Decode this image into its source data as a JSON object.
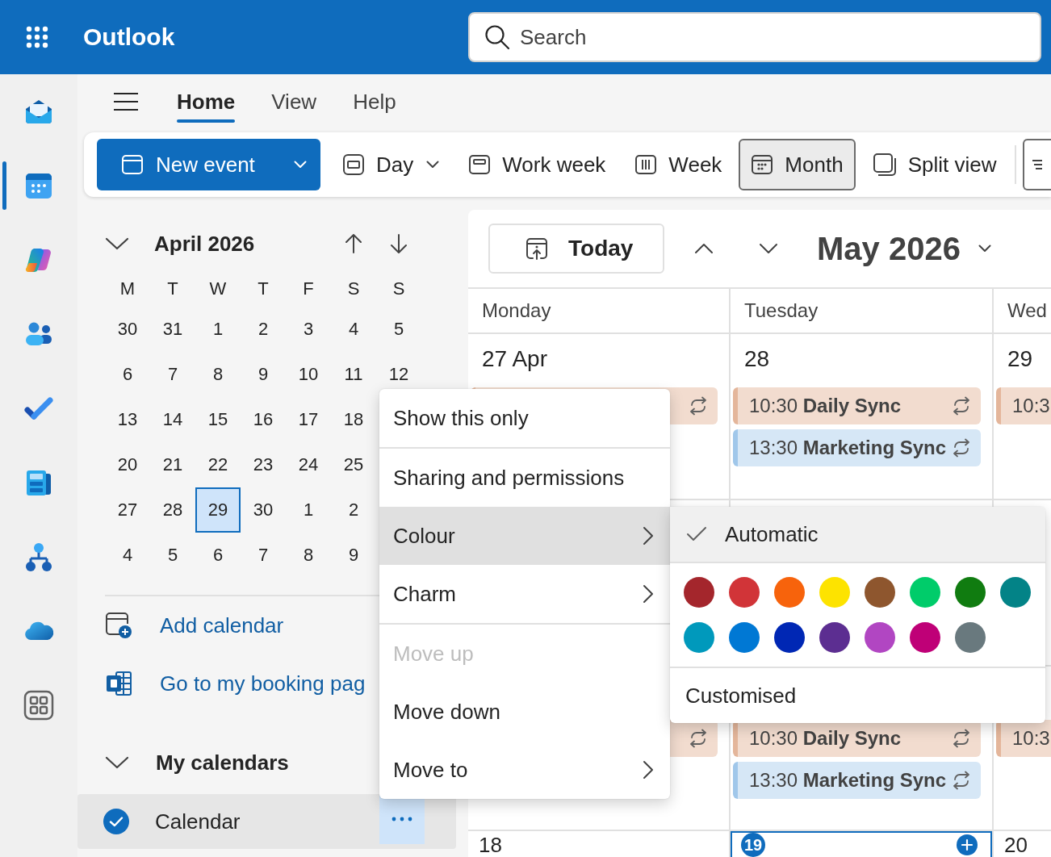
{
  "header": {
    "app_name": "Outlook",
    "search": {
      "placeholder": "Search"
    }
  },
  "rail": [
    {
      "kind": "mail",
      "selected": false
    },
    {
      "kind": "calendar",
      "selected": true
    },
    {
      "kind": "swirl",
      "selected": false
    },
    {
      "kind": "people",
      "selected": false
    },
    {
      "kind": "tasks",
      "selected": false
    },
    {
      "kind": "notebook",
      "selected": false
    },
    {
      "kind": "org",
      "selected": false
    },
    {
      "kind": "cloud",
      "selected": false
    },
    {
      "kind": "apps",
      "selected": false
    }
  ],
  "tabs": [
    {
      "label": "Home",
      "selected": true
    },
    {
      "label": "View",
      "selected": false
    },
    {
      "label": "Help",
      "selected": false
    }
  ],
  "toolbar": {
    "new_event": {
      "label": "New event"
    },
    "views": [
      {
        "kind": "day",
        "label": "Day",
        "dropdown": true,
        "selected": false
      },
      {
        "kind": "work_week",
        "label": "Work week",
        "dropdown": false,
        "selected": false
      },
      {
        "kind": "week",
        "label": "Week",
        "dropdown": false,
        "selected": false
      },
      {
        "kind": "month",
        "label": "Month",
        "dropdown": false,
        "selected": true
      },
      {
        "kind": "split",
        "label": "Split view",
        "dropdown": false,
        "selected": false
      }
    ]
  },
  "mini_calendar": {
    "title": "April 2026",
    "expanded": true,
    "weekdays": [
      "M",
      "T",
      "W",
      "T",
      "F",
      "S",
      "S"
    ],
    "weeks": [
      [
        {
          "day": "30",
          "selected": false
        },
        {
          "day": "31",
          "selected": false
        },
        {
          "day": "1",
          "selected": false
        },
        {
          "day": "2",
          "selected": false
        },
        {
          "day": "3",
          "selected": false
        },
        {
          "day": "4",
          "selected": false
        },
        {
          "day": "5",
          "selected": false
        }
      ],
      [
        {
          "day": "6",
          "selected": false
        },
        {
          "day": "7",
          "selected": false
        },
        {
          "day": "8",
          "selected": false
        },
        {
          "day": "9",
          "selected": false
        },
        {
          "day": "10",
          "selected": false
        },
        {
          "day": "11",
          "selected": false
        },
        {
          "day": "12",
          "selected": false
        }
      ],
      [
        {
          "day": "13",
          "selected": false
        },
        {
          "day": "14",
          "selected": false
        },
        {
          "day": "15",
          "selected": false
        },
        {
          "day": "16",
          "selected": false
        },
        {
          "day": "17",
          "selected": false
        },
        {
          "day": "18",
          "selected": false
        }
      ],
      [
        {
          "day": "20",
          "selected": false
        },
        {
          "day": "21",
          "selected": false
        },
        {
          "day": "22",
          "selected": false
        },
        {
          "day": "23",
          "selected": false
        },
        {
          "day": "24",
          "selected": false
        },
        {
          "day": "25",
          "selected": false
        }
      ],
      [
        {
          "day": "27",
          "selected": false
        },
        {
          "day": "28",
          "selected": false
        },
        {
          "day": "29",
          "selected": true
        },
        {
          "day": "30",
          "selected": false
        },
        {
          "day": "1",
          "selected": false
        },
        {
          "day": "2",
          "selected": false
        }
      ],
      [
        {
          "day": "4",
          "selected": false
        },
        {
          "day": "5",
          "selected": false
        },
        {
          "day": "6",
          "selected": false
        },
        {
          "day": "7",
          "selected": false
        },
        {
          "day": "8",
          "selected": false
        },
        {
          "day": "9",
          "selected": false
        }
      ]
    ]
  },
  "links": [
    {
      "kind": "add",
      "label": "Add calendar"
    },
    {
      "kind": "booking",
      "label": "Go to my booking pag"
    }
  ],
  "my_calendars": {
    "title": "My calendars",
    "expanded": true,
    "items": [
      {
        "name": "Calendar",
        "checked": true,
        "selected": true,
        "menu_open": true
      }
    ]
  },
  "calendar": {
    "today_label": "Today",
    "title": "May 2026",
    "columns": [
      "Monday",
      "Tuesday",
      "Wed"
    ],
    "weeks": [
      {
        "days": [
          {
            "date": "27 Apr",
            "today": false,
            "events": [
              {
                "color": "#f2dccf",
                "recurring": true
              }
            ]
          },
          {
            "date": "28",
            "today": false,
            "events": [
              {
                "time": "10:30",
                "title": "Daily Sync",
                "color": "#f2dccf",
                "recurring": true
              },
              {
                "time": "13:30",
                "title": "Marketing Sync",
                "color": "#d6e7f6",
                "recurring": true
              }
            ]
          },
          {
            "date": "29",
            "today": false,
            "events": [
              {
                "time": "10:3",
                "color": "#f2dccf"
              }
            ]
          }
        ]
      },
      {
        "days": [
          {
            "today": false
          },
          {
            "today": false
          },
          {
            "today": false
          }
        ]
      },
      {
        "days": [
          {
            "today": false,
            "events": [
              {
                "color": "#f2dccf",
                "recurring": true
              }
            ]
          },
          {
            "today": false,
            "events": [
              {
                "time": "10:30",
                "title": "Daily Sync",
                "color": "#f2dccf",
                "recurring": true
              },
              {
                "time": "13:30",
                "title": "Marketing Sync",
                "color": "#d6e7f6",
                "recurring": true
              }
            ]
          },
          {
            "today": false,
            "events": [
              {
                "time": "10:3",
                "color": "#f2dccf"
              }
            ]
          }
        ]
      },
      {
        "days": [
          {
            "date": "18",
            "today": false
          },
          {
            "date": "19",
            "today": true
          },
          {
            "date": "20",
            "today": false
          }
        ]
      }
    ]
  },
  "context_menu": {
    "groups": [
      [
        {
          "label": "Show this only",
          "highlighted": false,
          "disabled": false,
          "submenu": false
        }
      ],
      [
        {
          "label": "Sharing and permissions",
          "highlighted": false,
          "disabled": false,
          "submenu": false
        },
        {
          "label": "Colour",
          "highlighted": true,
          "disabled": false,
          "submenu": true
        },
        {
          "label": "Charm",
          "highlighted": false,
          "disabled": false,
          "submenu": true
        }
      ],
      [
        {
          "label": "Move up",
          "highlighted": false,
          "disabled": true,
          "submenu": false
        },
        {
          "label": "Move down",
          "highlighted": false,
          "disabled": false,
          "submenu": false
        },
        {
          "label": "Move to",
          "highlighted": false,
          "disabled": false,
          "submenu": true
        }
      ]
    ]
  },
  "colour_menu": {
    "automatic": {
      "label": "Automatic",
      "checked": true,
      "highlighted": true
    },
    "swatches": [
      {
        "color": "#a4262c",
        "selected": false
      },
      {
        "color": "#d13438",
        "selected": false
      },
      {
        "color": "#f7630c",
        "selected": false
      },
      {
        "color": "#fde300",
        "selected": false
      },
      {
        "color": "#8e562e",
        "selected": false
      },
      {
        "color": "#00cc6a",
        "selected": false
      },
      {
        "color": "#107c10",
        "selected": false
      },
      {
        "color": "#038387",
        "selected": false
      },
      {
        "color": "#0099bc",
        "selected": false
      },
      {
        "color": "#0078d4",
        "selected": false
      },
      {
        "color": "#0027b4",
        "selected": false
      },
      {
        "color": "#5c2e91",
        "selected": false
      },
      {
        "color": "#b146c2",
        "selected": false
      },
      {
        "color": "#bf0077",
        "selected": false
      },
      {
        "color": "#69797e",
        "selected": false
      }
    ],
    "customised": {
      "label": "Customised"
    }
  }
}
